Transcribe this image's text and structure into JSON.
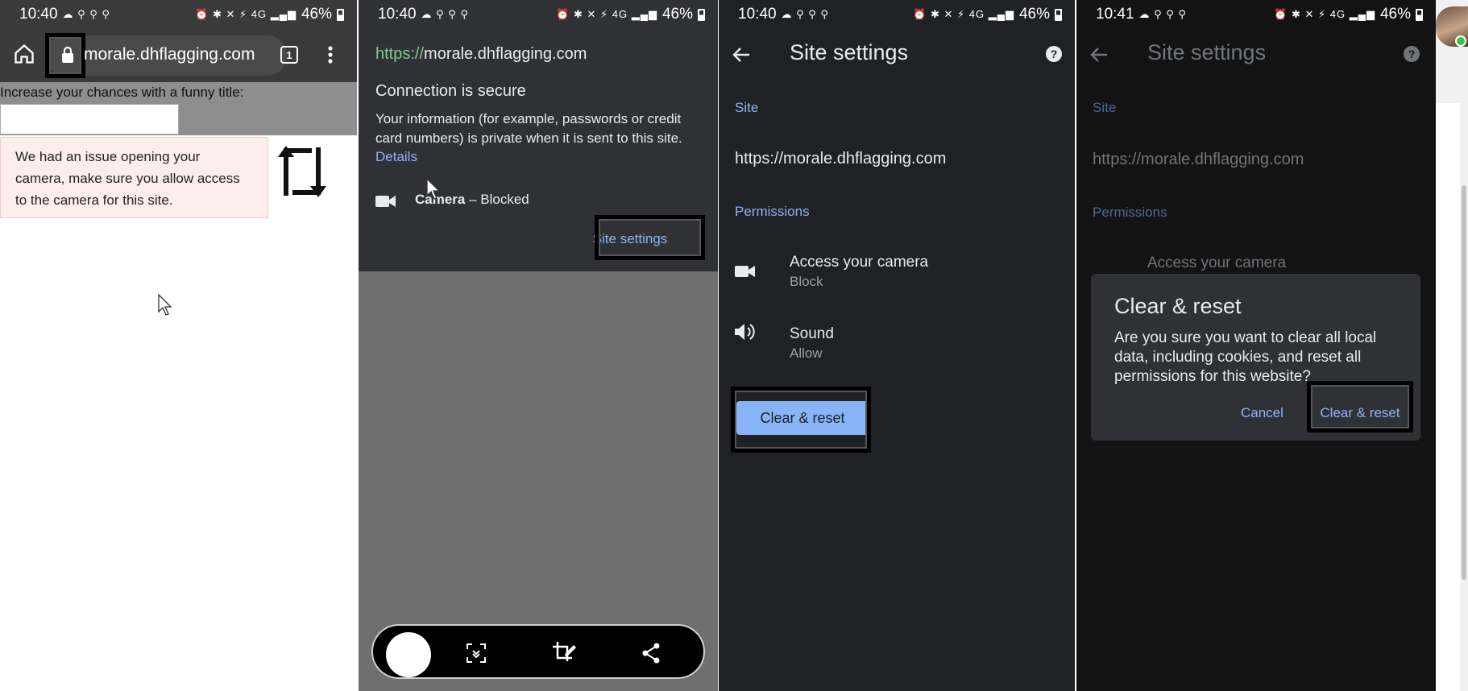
{
  "status": {
    "time_1": "10:40",
    "time_2": "10:40",
    "time_3": "10:40",
    "time_4": "10:41",
    "battery": "46%",
    "left_icons": "☁ ⚲ ⚲ ⚲",
    "right_icons": "⏰ ✱ ✕ ⚡ 4G ▂▄▆"
  },
  "panel1": {
    "url": "morale.dhflagging.com",
    "tab_count": "1",
    "input_label": "Increase your chances with a funny title:",
    "title_input_value": "",
    "error_message": "We had an issue opening your camera, make sure you allow access to the camera for this site.",
    "icons": [
      "home-icon",
      "lock-icon",
      "tab-switcher-icon",
      "more-vert-icon",
      "rotate-icon",
      "mouse-cursor"
    ]
  },
  "panel2": {
    "url_scheme": "https://",
    "url_host": "morale.dhflagging.com",
    "secure_title": "Connection is secure",
    "secure_info": "Your information (for example, passwords or credit card numbers) is private when it is sent to this site.",
    "details_link": "Details",
    "camera_label": "Camera",
    "camera_status": " – Blocked",
    "site_settings_button": "Site settings",
    "icons": [
      "videocam-icon",
      "screenshot-scroll-icon",
      "crop-edit-icon",
      "share-icon"
    ]
  },
  "panel3": {
    "title": "Site settings",
    "site_section": "Site",
    "site_url": "https://morale.dhflagging.com",
    "permissions_section": "Permissions",
    "camera_title": "Access your camera",
    "camera_value": "Block",
    "sound_title": "Sound",
    "sound_value": "Allow",
    "reset_button": "Clear & reset",
    "icons": [
      "back-arrow-icon",
      "help-icon",
      "videocam-icon",
      "volume-icon"
    ]
  },
  "panel4": {
    "title": "Site settings",
    "site_section": "Site",
    "site_url": "https://morale.dhflagging.com",
    "permissions_section": "Permissions",
    "camera_title": "Access your camera",
    "dialog_title": "Clear & reset",
    "dialog_message": "Are you sure you want to clear all local data, including cookies, and reset all permissions for this website?",
    "cancel_button": "Cancel",
    "confirm_button": "Clear & reset"
  },
  "colors": {
    "accent_blue": "#8ab4f8",
    "secure_green": "#81c995",
    "dark_bg": "#202124",
    "error_bg": "#fdeeee"
  }
}
